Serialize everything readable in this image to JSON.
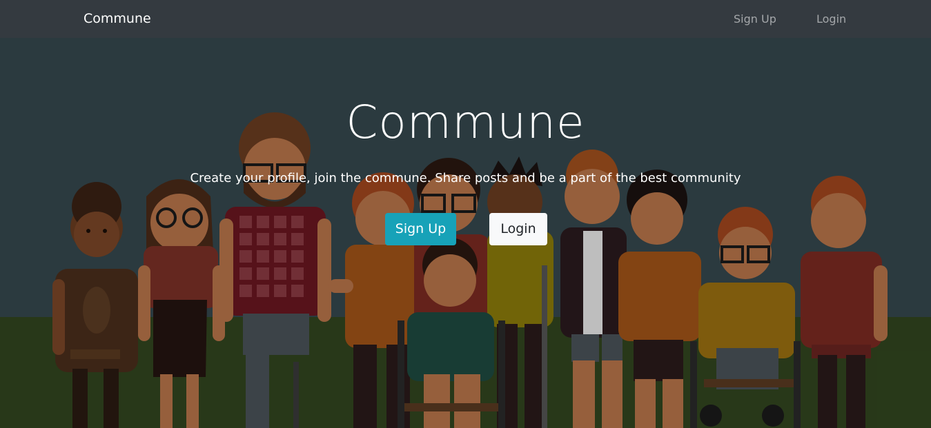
{
  "navbar": {
    "brand": "Commune",
    "links": [
      {
        "label": "Sign Up"
      },
      {
        "label": "Login"
      }
    ]
  },
  "hero": {
    "title": "Commune",
    "lead": "Create your profile, join the commune. Share posts and be a part of the best community",
    "signup_label": "Sign Up",
    "login_label": "Login"
  },
  "colors": {
    "navbar_bg": "#343a40",
    "primary_button": "#17a2b8",
    "light_button": "#f8f9fa"
  }
}
